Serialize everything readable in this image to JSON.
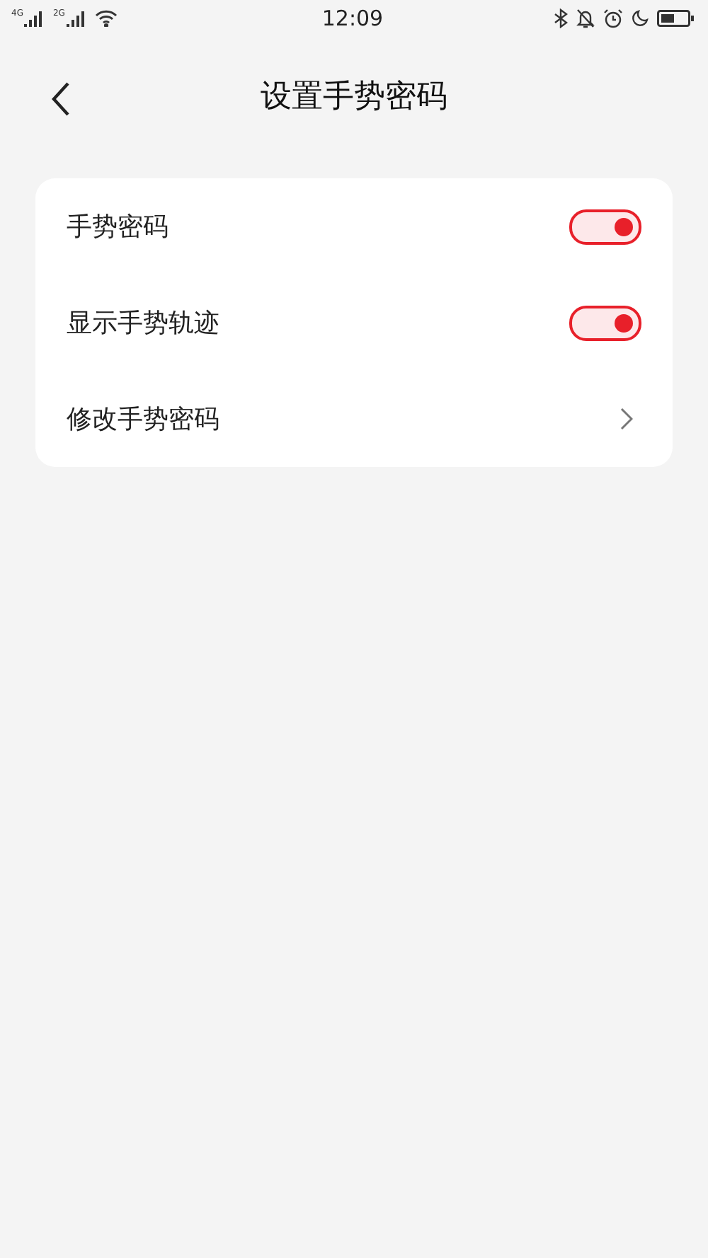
{
  "status_bar": {
    "sim_labels": [
      "4G",
      "2G"
    ],
    "time": "12:09"
  },
  "header": {
    "title": "设置手势密码"
  },
  "settings": [
    {
      "kind": "toggle",
      "label": "手势密码",
      "on": true
    },
    {
      "kind": "toggle",
      "label": "显示手势轨迹",
      "on": true
    },
    {
      "kind": "link",
      "label": "修改手势密码"
    }
  ]
}
